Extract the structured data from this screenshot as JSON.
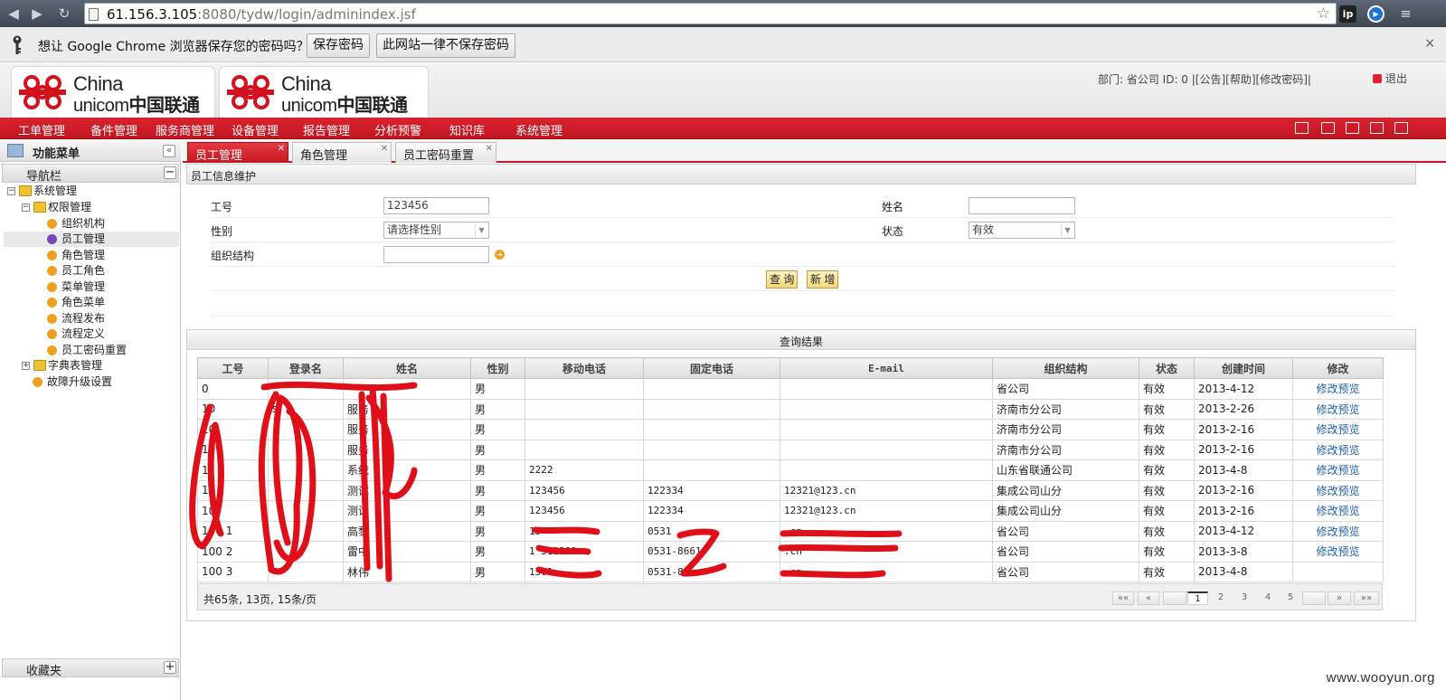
{
  "browser": {
    "url_host": "61.156.3.105",
    "url_port_path": ":8080/tydw/login/adminindex.jsf",
    "ext_ip": "ip"
  },
  "password_bar": {
    "message": "想让 Google Chrome 浏览器保存您的密码吗？",
    "save_label": "保存密码",
    "never_label": "此网站一律不保存密码",
    "close": "×"
  },
  "header": {
    "logo_en1": "China",
    "logo_en2": "unicom",
    "logo_cn": "中国联通",
    "info": "部门: 省公司  ID: 0  |[公告][帮助][修改密码]|",
    "exit_label": "退出"
  },
  "menu": [
    "工单管理",
    "备件管理",
    "服务商管理",
    "设备管理",
    "报告管理",
    "分析预警",
    "知识库",
    "系统管理"
  ],
  "left_panel": {
    "title": "功能菜单",
    "collapse": "«",
    "nav_title": "导航栏",
    "nav_toggle": "−",
    "tree": {
      "root": "系统管理",
      "group1": "权限管理",
      "leaves": [
        "组织机构",
        "员工管理",
        "角色管理",
        "员工角色",
        "菜单管理",
        "角色菜单",
        "流程发布",
        "流程定义",
        "员工密码重置"
      ],
      "group2": "字典表管理",
      "leaf2": "故障升级设置"
    },
    "favorites": "收藏夹",
    "fav_toggle": "+"
  },
  "tabs": [
    {
      "label": "员工管理",
      "active": true
    },
    {
      "label": "角色管理",
      "active": false
    },
    {
      "label": "员工密码重置",
      "active": false
    }
  ],
  "form": {
    "title": "员工信息维护",
    "emp_no_label": "工号",
    "emp_no_value": "123456",
    "name_label": "姓名",
    "name_value": "",
    "gender_label": "性别",
    "gender_value": "请选择性别",
    "status_label": "状态",
    "status_value": "有效",
    "org_label": "组织结构",
    "org_value": "",
    "query_button": "查 询",
    "add_button": "新 增"
  },
  "results": {
    "title": "查询结果",
    "columns": [
      "工号",
      "登录名",
      "姓名",
      "性别",
      "移动电话",
      "固定电话",
      "E-mail",
      "组织结构",
      "状态",
      "创建时间",
      "修改"
    ],
    "rows": [
      [
        "0",
        "",
        "",
        "男",
        "",
        "",
        "",
        "省公司",
        "有效",
        "2013-4-12",
        "修改预览"
      ],
      [
        "10",
        "s",
        "服务",
        "男",
        "",
        "",
        "",
        "济南市分公司",
        "有效",
        "2013-2-26",
        "修改预览"
      ],
      [
        "10",
        "",
        "服务",
        "男",
        "",
        "",
        "",
        "济南市分公司",
        "有效",
        "2013-2-16",
        "修改预览"
      ],
      [
        "10",
        "",
        "服务",
        "男",
        "",
        "",
        "",
        "济南市分公司",
        "有效",
        "2013-2-16",
        "修改预览"
      ],
      [
        "1",
        "",
        "系统",
        "男",
        "2222",
        "",
        "",
        "山东省联通公司",
        "有效",
        "2013-4-8",
        "修改预览"
      ],
      [
        "10",
        "",
        "测试",
        "男",
        "123456",
        "122334",
        "12321@123.cn",
        "集成公司山分",
        "有效",
        "2013-2-16",
        "修改预览"
      ],
      [
        "10",
        "",
        "测试",
        "男",
        "123456",
        "122334",
        "12321@123.cn",
        "集成公司山分",
        "有效",
        "2013-2-16",
        "修改预览"
      ],
      [
        "100 1",
        "",
        "高黎",
        "男",
        "15",
        "0531",
        ".cn",
        "省公司",
        "有效",
        "2013-4-12",
        "修改预览"
      ],
      [
        "100 2",
        "",
        "雷中",
        "男",
        "1 512291",
        "0531-8661",
        ".cn",
        "省公司",
        "有效",
        "2013-3-8",
        "修改预览"
      ],
      [
        "100 3",
        "",
        "林伟",
        "男",
        "1561",
        "0531-86",
        ".cn",
        "省公司",
        "有效",
        "2013-4-8",
        ""
      ]
    ],
    "summary": "共65条, 13页, 15条/页",
    "pager": {
      "first": "««",
      "prev": "«",
      "pages": [
        "1",
        "2",
        "3",
        "4",
        "5"
      ],
      "current": "1",
      "next": "»",
      "last": "»»"
    }
  },
  "colors": {
    "brand_red": "#c41822",
    "link_blue": "#1f5fa8",
    "scribble_red": "#e0101a"
  },
  "watermark": "www.wooyun.org"
}
